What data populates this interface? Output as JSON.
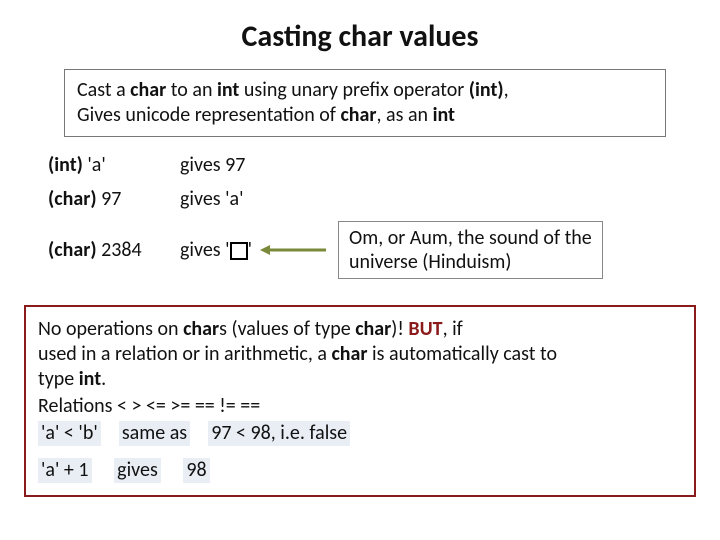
{
  "title": "Casting char values",
  "intro": {
    "t1": "Cast a ",
    "b1": "char",
    "t2": " to an ",
    "b2": "int",
    "t3": " using unary prefix operator ",
    "b3": "(int)",
    "t4": ",",
    "line2a": "Gives unicode representation of ",
    "line2b": "char",
    "line2c": ", as an ",
    "line2d": "int"
  },
  "ex": {
    "r1_left_b": "(int)",
    "r1_left_t": " 'a'",
    "r1_mid": "gives 97",
    "r2_left_b": "(char)",
    "r2_left_t": " 97",
    "r2_mid": "gives 'a'",
    "r3_left_b": "(char)",
    "r3_left_t": " 2384",
    "r3_mid_a": "gives  '",
    "r3_mid_b": "'"
  },
  "om_note": {
    "l1": "Om, or Aum, the sound of the",
    "l2": "universe (Hinduism)"
  },
  "rules": {
    "p1a": "No operations on ",
    "p1b": "char",
    "p1c": "s (values of type ",
    "p1d": "char",
    "p1e": ")!  ",
    "but": "BUT",
    "p1f": ", if",
    "p2a": "used in a relation or in arithmetic, a ",
    "p2b": "char",
    "p2c": " is automatically cast to",
    "p3a": "type ",
    "p3b": "int",
    "p3c": ".",
    "rel": "Relations  <    >    <=  >=    ==   !=    ==",
    "ex1a": "'a' < 'b'",
    "ex1b": "same as",
    "ex1c": "97 < 98, i.e. false",
    "ex2a": "'a' + 1",
    "ex2b": "gives",
    "ex2c": "98"
  }
}
